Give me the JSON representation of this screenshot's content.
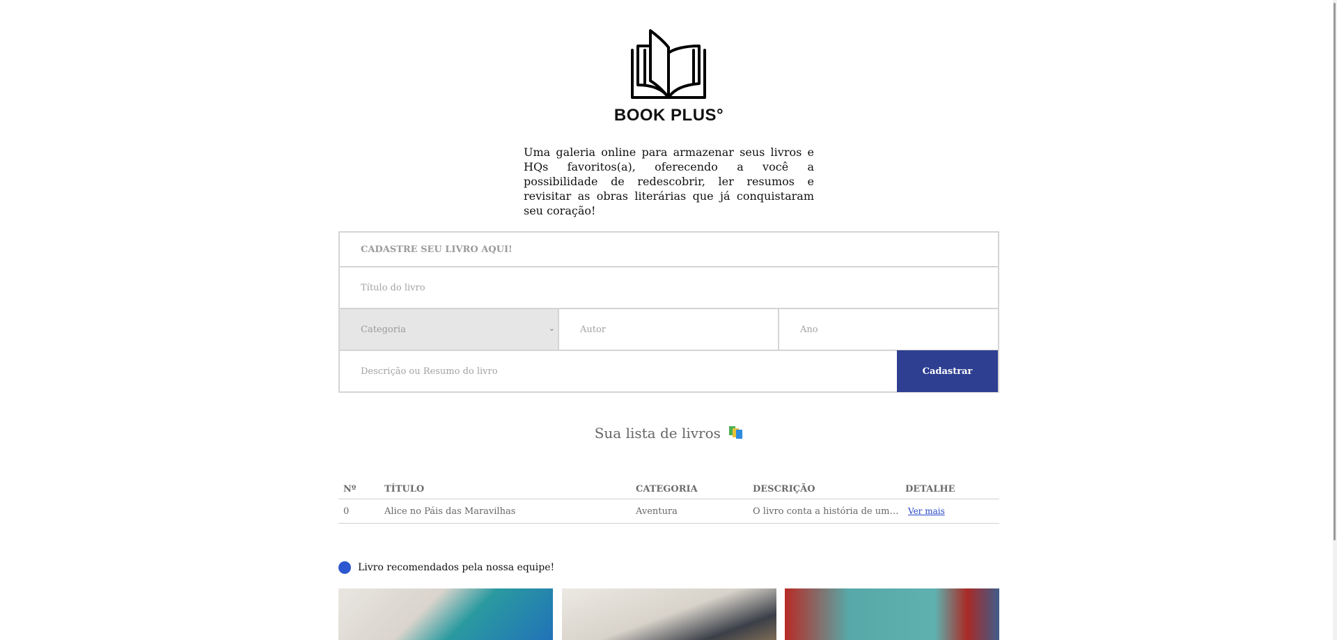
{
  "brand": {
    "name": "BOOK PLUS°",
    "logo_icon": "open-book-icon"
  },
  "intro": "Uma galeria online para armazenar seus livros e HQs favoritos(a), oferecendo a você a possibilidade de redescobrir, ler resumos e revisitar as obras literárias que já conquistaram seu coração!",
  "form": {
    "heading": "CADASTRE SEU LIVRO AQUI!",
    "title_placeholder": "Título do livro",
    "category_selected": "Categoria",
    "author_placeholder": "Autor",
    "year_placeholder": "Ano",
    "description_placeholder": "Descrição ou Resumo do livro",
    "submit_label": "Cadastrar"
  },
  "list": {
    "title": "Sua lista de livros",
    "icon": "books-icon",
    "columns": [
      "Nº",
      "TÍTULO",
      "CATEGORIA",
      "DESCRIÇÃO",
      "DETALHE"
    ],
    "rows": [
      {
        "number": "0",
        "title": "Alice no Páis das Maravilhas",
        "category": "Aventura",
        "description": "O livro conta a história de uma...",
        "detail_link": "Ver mais"
      }
    ]
  },
  "recommended": {
    "label": "Livro recomendados pela nossa equipe!",
    "colors": {
      "dot": "#2d57cf",
      "button": "#2e3f91",
      "link": "#2846c8"
    }
  }
}
